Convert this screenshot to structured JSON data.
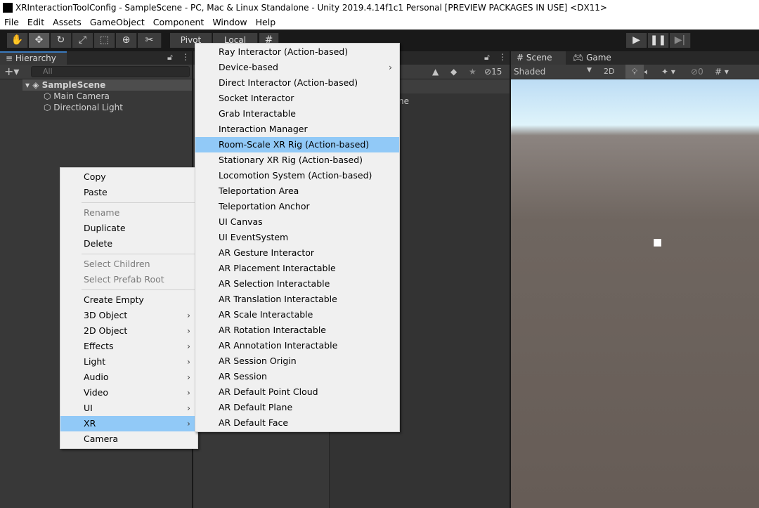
{
  "window": {
    "title": "XRInteractionToolConfig - SampleScene - PC, Mac & Linux Standalone - Unity 2019.4.14f1c1 Personal [PREVIEW PACKAGES IN USE] <DX11>"
  },
  "menubar": [
    "File",
    "Edit",
    "Assets",
    "GameObject",
    "Component",
    "Window",
    "Help"
  ],
  "toolbar": {
    "pivot": "Pivot",
    "local": "Local",
    "tools": [
      "hand-icon",
      "move-icon",
      "rotate-icon",
      "scale-icon",
      "rect-icon",
      "transform-icon",
      "custom-tool-icon"
    ]
  },
  "hierarchy": {
    "tab": "Hierarchy",
    "search_placeholder": "All",
    "scene": "SampleScene",
    "items": [
      "Main Camera",
      "Directional Light"
    ]
  },
  "project": {
    "hidden_count": "15",
    "partial_label": "ne"
  },
  "scene": {
    "tabs": [
      "Scene",
      "Game"
    ],
    "shading": "Shaded",
    "mode_2d": "2D",
    "hidden_count": "0"
  },
  "context_menu": {
    "items": [
      {
        "label": "Copy"
      },
      {
        "label": "Paste"
      },
      {
        "sep": true
      },
      {
        "label": "Rename",
        "disabled": true
      },
      {
        "label": "Duplicate"
      },
      {
        "label": "Delete"
      },
      {
        "sep": true
      },
      {
        "label": "Select Children",
        "disabled": true
      },
      {
        "label": "Select Prefab Root",
        "disabled": true
      },
      {
        "sep": true
      },
      {
        "label": "Create Empty"
      },
      {
        "label": "3D Object",
        "sub": true
      },
      {
        "label": "2D Object",
        "sub": true
      },
      {
        "label": "Effects",
        "sub": true
      },
      {
        "label": "Light",
        "sub": true
      },
      {
        "label": "Audio",
        "sub": true
      },
      {
        "label": "Video",
        "sub": true
      },
      {
        "label": "UI",
        "sub": true
      },
      {
        "label": "XR",
        "sub": true,
        "highlighted": true
      },
      {
        "label": "Camera"
      }
    ]
  },
  "xr_submenu": {
    "items": [
      {
        "label": "Ray Interactor (Action-based)"
      },
      {
        "label": "Device-based",
        "sub": true
      },
      {
        "label": "Direct Interactor (Action-based)"
      },
      {
        "label": "Socket Interactor"
      },
      {
        "label": "Grab Interactable"
      },
      {
        "label": "Interaction Manager"
      },
      {
        "label": "Room-Scale XR Rig (Action-based)",
        "highlighted": true
      },
      {
        "label": "Stationary XR Rig (Action-based)"
      },
      {
        "label": "Locomotion System (Action-based)"
      },
      {
        "label": "Teleportation Area"
      },
      {
        "label": "Teleportation Anchor"
      },
      {
        "label": "UI Canvas"
      },
      {
        "label": "UI EventSystem"
      },
      {
        "label": "AR Gesture Interactor"
      },
      {
        "label": "AR Placement Interactable"
      },
      {
        "label": "AR Selection Interactable"
      },
      {
        "label": "AR Translation Interactable"
      },
      {
        "label": "AR Scale Interactable"
      },
      {
        "label": "AR Rotation Interactable"
      },
      {
        "label": "AR Annotation Interactable"
      },
      {
        "label": "AR Session Origin"
      },
      {
        "label": "AR Session"
      },
      {
        "label": "AR Default Point Cloud"
      },
      {
        "label": "AR Default Plane"
      },
      {
        "label": "AR Default Face"
      }
    ]
  },
  "colors": {
    "highlight": "#91c9f7",
    "menu_bg": "#f0f0f0",
    "panel_bg": "#383838"
  }
}
